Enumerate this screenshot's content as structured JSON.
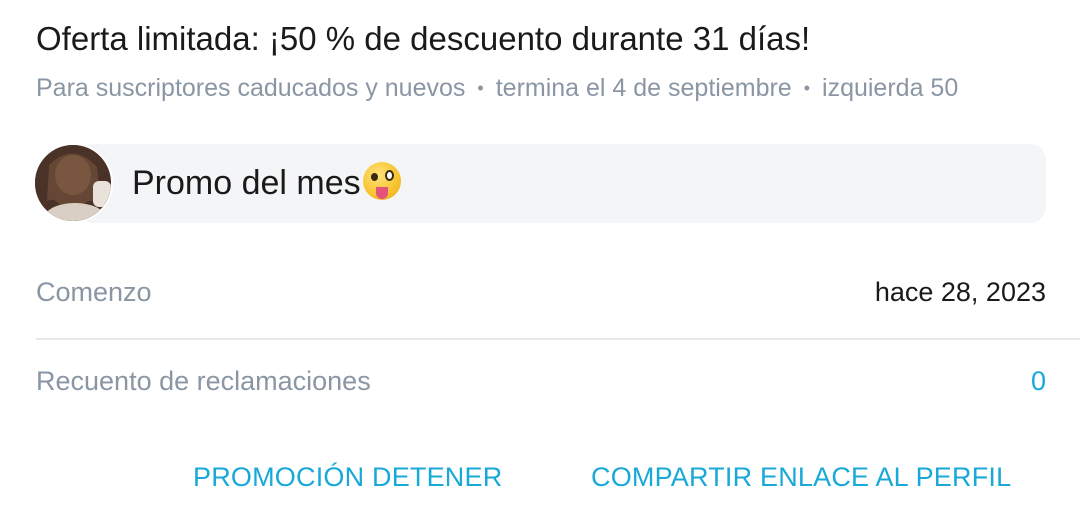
{
  "offer": {
    "title": "Oferta limitada: ¡50 % de descuento durante 31 días!",
    "subtitle_audience": "Para suscriptores caducados y nuevos",
    "subtitle_ends": "termina el 4 de septiembre",
    "subtitle_left": "izquierda 50",
    "separator": "•"
  },
  "promo": {
    "message": "Promo del mes",
    "emoji_icon": "zany-face-emoji-icon",
    "avatar": "user-avatar"
  },
  "details": {
    "start_label": "Comenzo",
    "start_value": "hace 28, 2023",
    "claims_label": "Recuento de reclamaciones",
    "claims_value": "0"
  },
  "actions": {
    "stop_label": "PROMOCIÓN DETENER",
    "share_label": "COMPARTIR ENLACE AL PERFIL"
  },
  "colors": {
    "accent": "#18a9d8",
    "muted_text": "#8a96a3",
    "primary_text": "#1a1a1a",
    "promo_bg": "#f4f5f7"
  }
}
